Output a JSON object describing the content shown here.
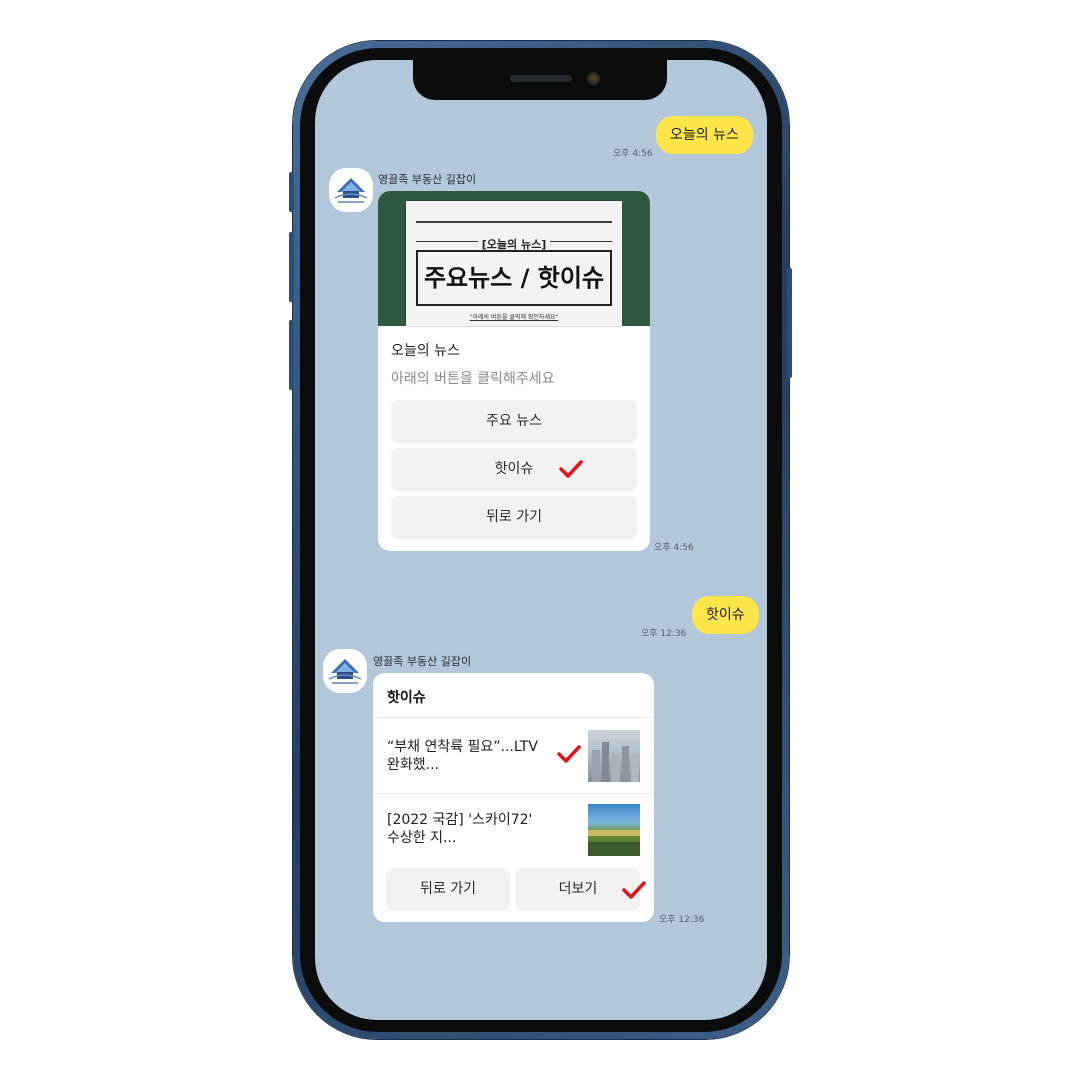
{
  "chat": {
    "msg1": {
      "text": "오늘의 뉴스",
      "time": "오후 4:56"
    },
    "bot_name": "영끌족 부동산 길잡이",
    "card1": {
      "image": {
        "header": "[오늘의 뉴스]",
        "title": "주요뉴스 / 핫이슈",
        "sub": "\"아래의 버튼을 클릭해 확인하세요\""
      },
      "title": "오늘의 뉴스",
      "description": "아래의 버튼을 클릭해주세요",
      "buttons": [
        "주요 뉴스",
        "핫이슈",
        "뒤로 가기"
      ],
      "time": "오후 4:56"
    },
    "msg2": {
      "text": "핫이슈",
      "time": "오후 12:36"
    },
    "card2": {
      "header": "핫이슈",
      "items": [
        {
          "line1": "“부채 연착륙 필요”...LTV",
          "line2": "완화했..."
        },
        {
          "line1": "[2022 국감] '스카이72'",
          "line2": "수상한 지..."
        }
      ],
      "buttons": [
        "뒤로 가기",
        "더보기"
      ],
      "time": "오후 12:36"
    }
  },
  "colors": {
    "chat_bg": "#b2c7da",
    "my_bubble": "#fde54a",
    "check": "#e0141b",
    "frame": "#2e4d73"
  },
  "icons": [
    "check-icon",
    "avatar-logo-icon",
    "camera-icon"
  ]
}
